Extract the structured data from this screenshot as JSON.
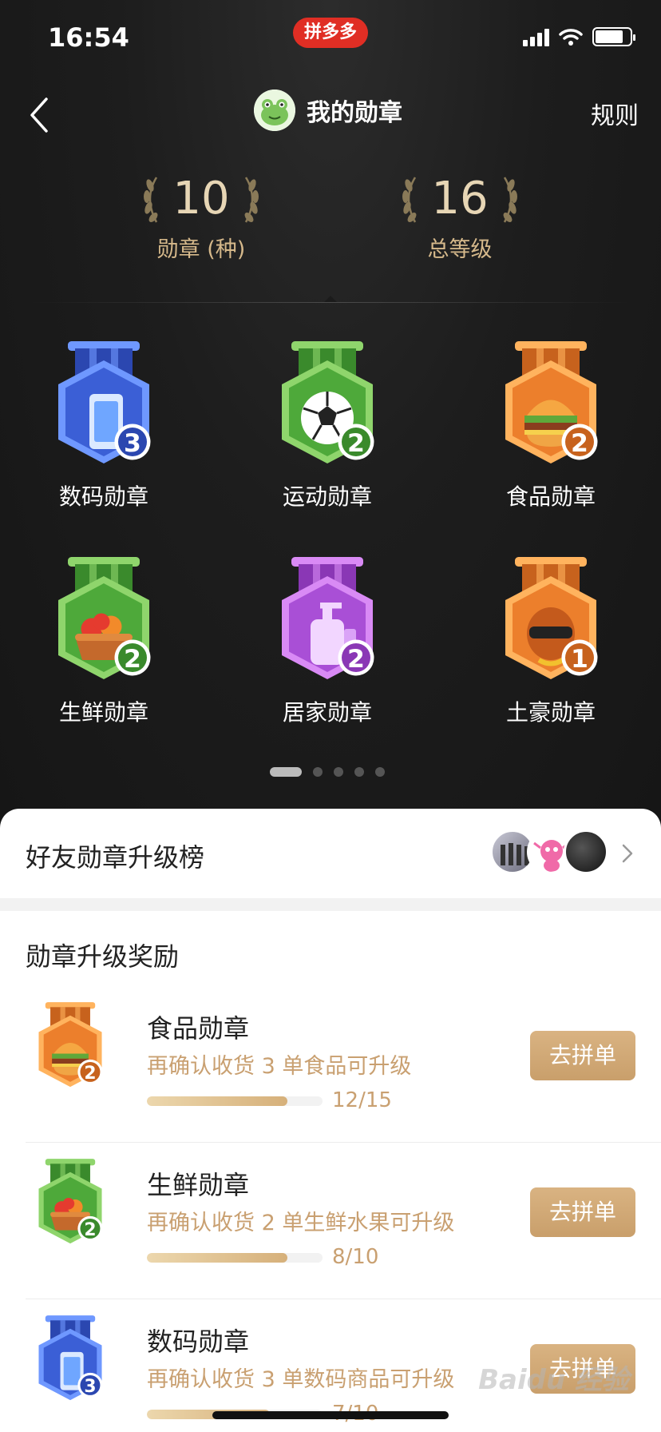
{
  "status_bar": {
    "time": "16:54",
    "app_name": "拼多多"
  },
  "header": {
    "title": "我的勋章",
    "rules": "规则"
  },
  "stats": [
    {
      "value": "10",
      "label": "勋章 (种)"
    },
    {
      "value": "16",
      "label": "总等级"
    }
  ],
  "badges": [
    {
      "label": "数码勋章",
      "level": "3",
      "theme": "blue",
      "emblem": "phone-icon"
    },
    {
      "label": "运动勋章",
      "level": "2",
      "theme": "green",
      "emblem": "soccer-ball-icon"
    },
    {
      "label": "食品勋章",
      "level": "2",
      "theme": "orange",
      "emblem": "burger-icon"
    },
    {
      "label": "生鲜勋章",
      "level": "2",
      "theme": "green",
      "emblem": "fruit-basket-icon"
    },
    {
      "label": "居家勋章",
      "level": "2",
      "theme": "purple",
      "emblem": "lotion-bottle-icon"
    },
    {
      "label": "土豪勋章",
      "level": "1",
      "theme": "orange",
      "emblem": "rich-character-icon"
    }
  ],
  "pager": {
    "total": 5,
    "active": 0
  },
  "friends": {
    "title": "好友勋章升级榜"
  },
  "rewards": {
    "title": "勋章升级奖励",
    "items": [
      {
        "name": "食品勋章",
        "hint": "再确认收货 3 单食品可升级",
        "progress_text": "12/15",
        "progress": 0.8,
        "button": "去拼单",
        "level": "2",
        "theme": "orange"
      },
      {
        "name": "生鲜勋章",
        "hint": "再确认收货 2 单生鲜水果可升级",
        "progress_text": "8/10",
        "progress": 0.8,
        "button": "去拼单",
        "level": "2",
        "theme": "green"
      },
      {
        "name": "数码勋章",
        "hint": "再确认收货 3 单数码商品可升级",
        "progress_text": "7/10",
        "progress": 0.7,
        "button": "去拼单",
        "level": "3",
        "theme": "blue"
      }
    ]
  },
  "colors": {
    "blue": "#4f7cf0",
    "green": "#5fb84a",
    "orange": "#f0923a",
    "purple": "#b25de0",
    "gold_text": "#d6b98b",
    "button": "#d2aa76"
  },
  "watermark": "Baidu 经验"
}
